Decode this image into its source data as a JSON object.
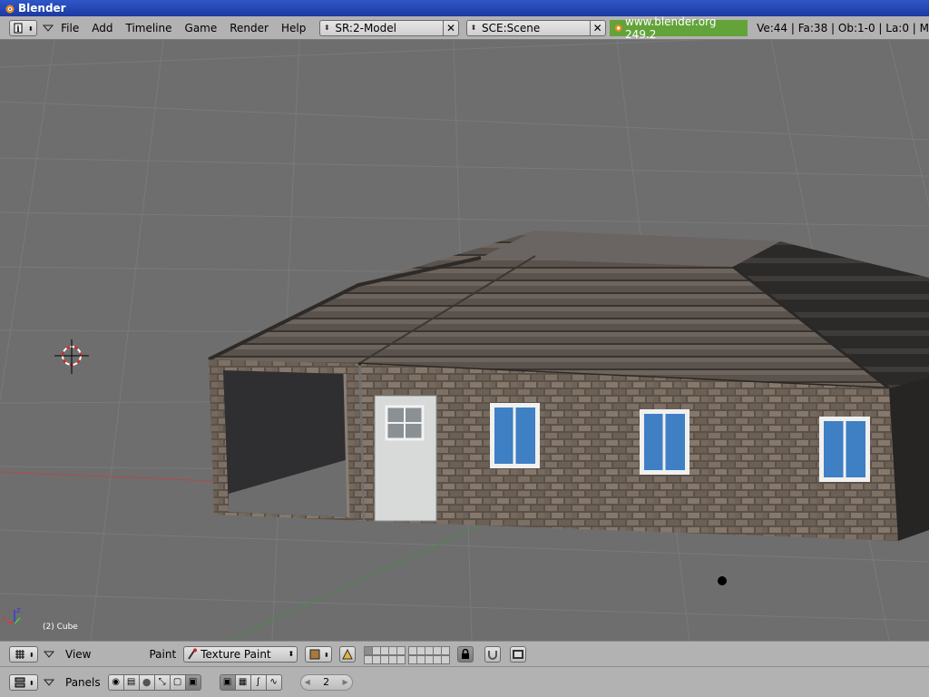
{
  "window": {
    "title": "Blender"
  },
  "header": {
    "menu": [
      "File",
      "Add",
      "Timeline",
      "Game",
      "Render",
      "Help"
    ],
    "screen": {
      "label": "SR:2-Model"
    },
    "scene": {
      "label": "SCE:Scene"
    },
    "url": "www.blender.org 249.2",
    "stats": "Ve:44 | Fa:38 | Ob:1-0 | La:0  | M"
  },
  "viewport": {
    "object_label": "(2) Cube",
    "axis_labels": {
      "z": "z",
      "x": "x"
    }
  },
  "view_header": {
    "view_label": "View",
    "paint_label": "Paint",
    "mode": {
      "label": "Texture Paint"
    }
  },
  "buttons_header": {
    "panels_label": "Panels",
    "frame_value": "2"
  },
  "colors": {
    "accent_green": "#62a33a",
    "title_blue": "#2f56c7",
    "header_gray": "#b2b2b2",
    "viewport_gray": "#6e6e6e"
  }
}
